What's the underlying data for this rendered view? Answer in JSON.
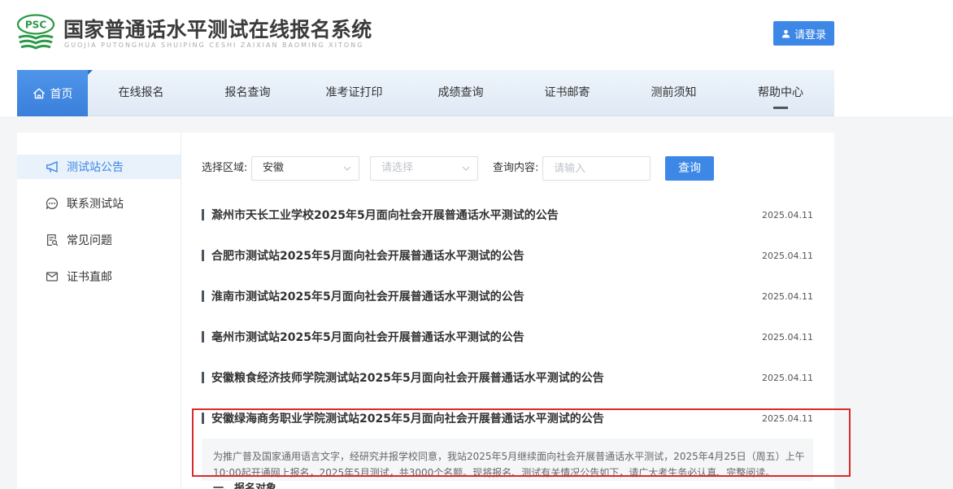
{
  "header": {
    "logo_text": "PSC",
    "title": "国家普通话水平测试在线报名系统",
    "subtitle": "GUOJIA PUTONGHUA SHUIPING CESHI ZAIXIAN BAOMING XITONG",
    "login": {
      "label": "请登录",
      "icon": "user-icon"
    }
  },
  "nav": {
    "items": [
      {
        "label": "首页",
        "icon": "home-icon",
        "active": true
      },
      {
        "label": "在线报名"
      },
      {
        "label": "报名查询"
      },
      {
        "label": "准考证打印"
      },
      {
        "label": "成绩查询"
      },
      {
        "label": "证书邮寄"
      },
      {
        "label": "测前须知"
      },
      {
        "label": "帮助中心",
        "hover_indicator": true
      }
    ]
  },
  "sidebar": {
    "items": [
      {
        "label": "测试站公告",
        "icon": "megaphone-icon",
        "active": true
      },
      {
        "label": "联系测试站",
        "icon": "chat-icon"
      },
      {
        "label": "常见问题",
        "icon": "faq-document-icon"
      },
      {
        "label": "证书直邮",
        "icon": "mail-icon"
      }
    ]
  },
  "filters": {
    "region_label": "选择区域:",
    "province": {
      "value": "安徽"
    },
    "city": {
      "placeholder": "请选择"
    },
    "keyword_label": "查询内容:",
    "keyword": {
      "placeholder": "请输入"
    },
    "search_label": "查询"
  },
  "announcements": [
    {
      "title": "滁州市天长工业学校2025年5月面向社会开展普通话水平测试的公告",
      "date": "2025.04.11"
    },
    {
      "title": "合肥市测试站2025年5月面向社会开展普通话水平测试的公告",
      "date": "2025.04.11"
    },
    {
      "title": "淮南市测试站2025年5月面向社会开展普通话水平测试的公告",
      "date": "2025.04.11"
    },
    {
      "title": "亳州市测试站2025年5月面向社会开展普通话水平测试的公告",
      "date": "2025.04.11"
    },
    {
      "title": "安徽粮食经济技师学院测试站2025年5月面向社会开展普通话水平测试的公告",
      "date": "2025.04.11"
    },
    {
      "title": "安徽绿海商务职业学院测试站2025年5月面向社会开展普通话水平测试的公告",
      "date": "2025.04.11"
    }
  ],
  "expanded": {
    "summary": "为推广普及国家通用语言文字，经研究并报学校同意，我站2025年5月继续面向社会开展普通话水平测试，2025年4月25日（周五）上午10:00起开通网上报名，2025年5月测试，共3000个名额。现将报名、测试有关情况公告如下，请广大考生务必认真、完整阅读。",
    "next_heading": "一、报名对象"
  },
  "colors": {
    "accent": "#3d87e6",
    "annotation": "#d92b2b",
    "page_bg": "#f4f5f7",
    "logo_green": "#2c9a48"
  }
}
